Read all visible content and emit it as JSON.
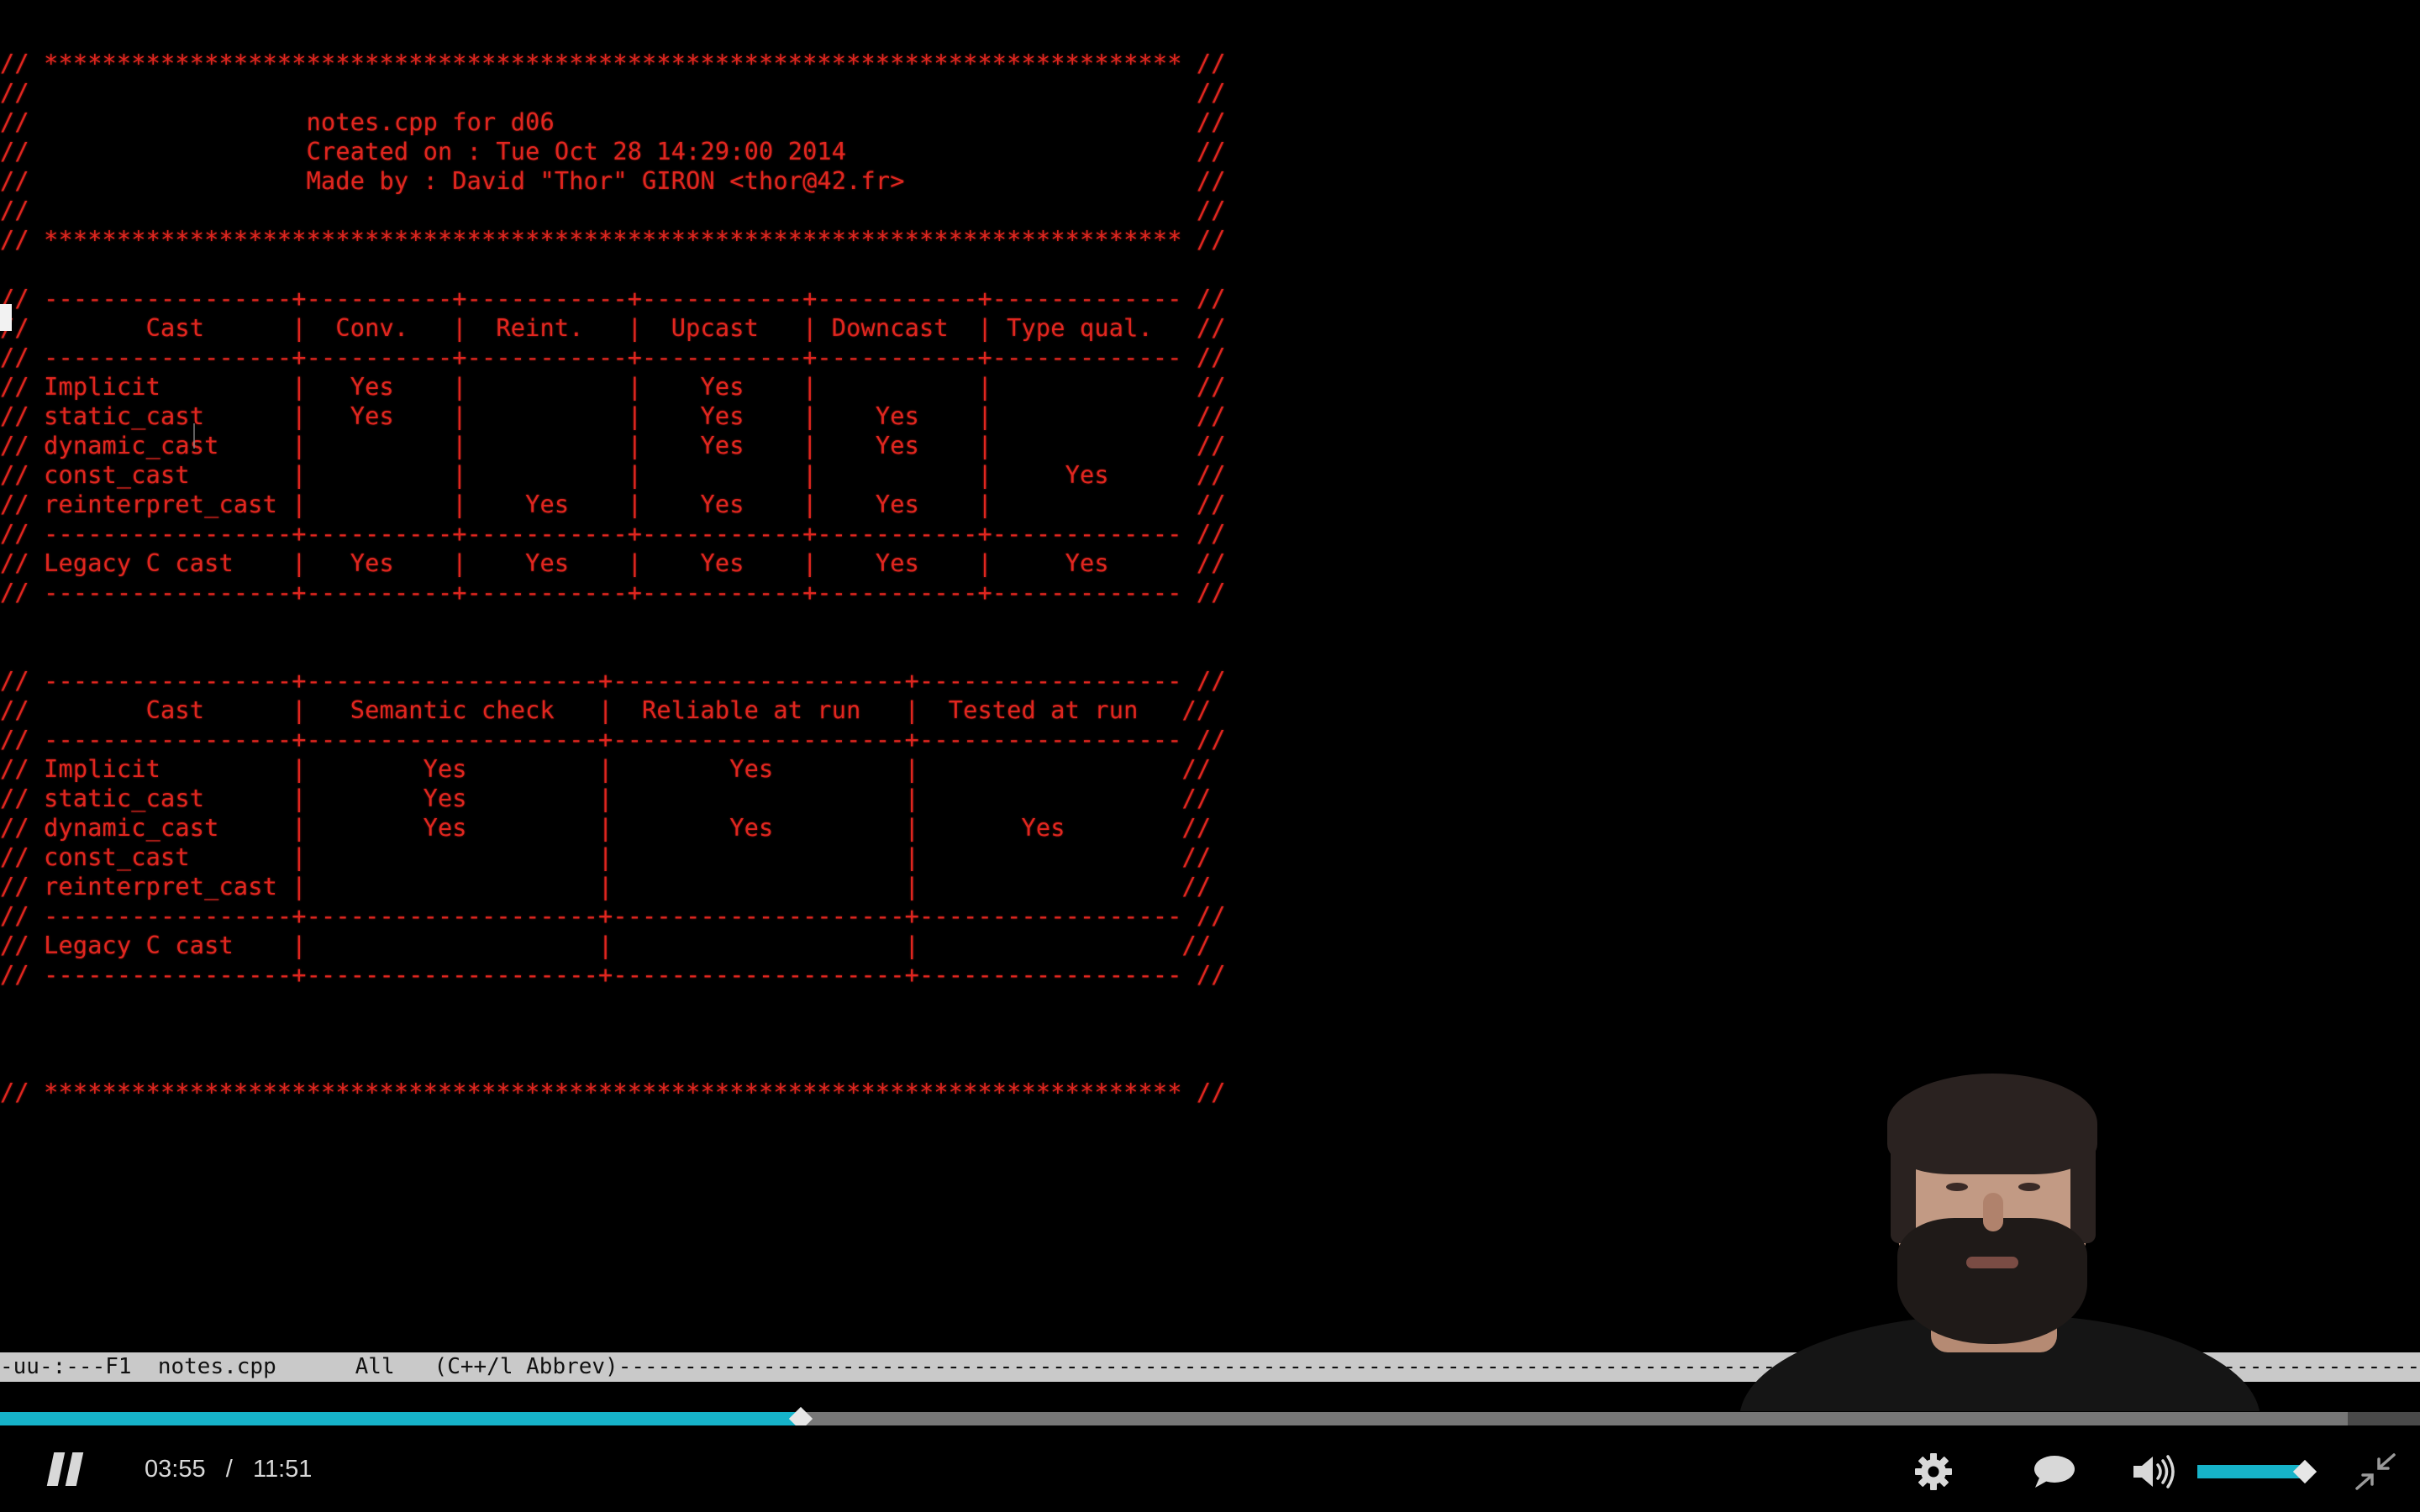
{
  "editor": {
    "lines": [
      {
        "row": 1,
        "text": "// ****************************************************************************** //"
      },
      {
        "row": 2,
        "text": "//                                                                                //"
      },
      {
        "row": 3,
        "text": "//                   notes.cpp for d06                                            //"
      },
      {
        "row": 4,
        "text": "//                   Created on : Tue Oct 28 14:29:00 2014                        //"
      },
      {
        "row": 5,
        "text": "//                   Made by : David \"Thor\" GIRON <thor@42.fr>                    //"
      },
      {
        "row": 6,
        "text": "//                                                                                //"
      },
      {
        "row": 7,
        "text": "// ****************************************************************************** //"
      },
      {
        "row": 9,
        "text": "// -----------------+----------+-----------+-----------+-----------+------------- //"
      },
      {
        "row": 10,
        "text": "//        Cast      |  Conv.   |  Reint.   |  Upcast   | Downcast  | Type qual.   //"
      },
      {
        "row": 11,
        "text": "// -----------------+----------+-----------+-----------+-----------+------------- //"
      },
      {
        "row": 12,
        "text": "// Implicit         |   Yes    |           |    Yes    |           |              //"
      },
      {
        "row": 13,
        "text": "// static_cast      |   Yes    |           |    Yes    |    Yes    |              //"
      },
      {
        "row": 14,
        "text": "// dynamic_cast     |          |           |    Yes    |    Yes    |              //"
      },
      {
        "row": 15,
        "text": "// const_cast       |          |           |           |           |     Yes      //"
      },
      {
        "row": 16,
        "text": "// reinterpret_cast |          |    Yes    |    Yes    |    Yes    |              //"
      },
      {
        "row": 17,
        "text": "// -----------------+----------+-----------+-----------+-----------+------------- //"
      },
      {
        "row": 18,
        "text": "// Legacy C cast    |   Yes    |    Yes    |    Yes    |    Yes    |     Yes      //"
      },
      {
        "row": 19,
        "text": "// -----------------+----------+-----------+-----------+-----------+------------- //"
      },
      {
        "row": 22,
        "text": "// -----------------+--------------------+--------------------+------------------ //"
      },
      {
        "row": 23,
        "text": "//        Cast      |   Semantic check   |  Reliable at run   |  Tested at run   //"
      },
      {
        "row": 24,
        "text": "// -----------------+--------------------+--------------------+------------------ //"
      },
      {
        "row": 25,
        "text": "// Implicit         |        Yes         |        Yes         |                  //"
      },
      {
        "row": 26,
        "text": "// static_cast      |        Yes         |                    |                  //"
      },
      {
        "row": 27,
        "text": "// dynamic_cast     |        Yes         |        Yes         |       Yes        //"
      },
      {
        "row": 28,
        "text": "// const_cast       |                    |                    |                  //"
      },
      {
        "row": 29,
        "text": "// reinterpret_cast |                    |                    |                  //"
      },
      {
        "row": 30,
        "text": "// -----------------+--------------------+--------------------+------------------ //"
      },
      {
        "row": 31,
        "text": "// Legacy C cast    |                    |                    |                  //"
      },
      {
        "row": 32,
        "text": "// -----------------+--------------------+--------------------+------------------ //"
      },
      {
        "row": 36,
        "text": "// ****************************************************************************** //"
      }
    ],
    "modeline": "-uu-:---F1  notes.cpp      All   (C++/l Abbrev)-----------------------------------------------------------------------------------------------------------------------------------------------------------------------------------------------------------------"
  },
  "player": {
    "progress_fraction": 0.331,
    "buffered_fraction": 0.97,
    "current_time": "03:55",
    "time_separator": "/",
    "duration": "11:51",
    "volume_fraction": 0.9,
    "icons": {
      "play_pause": "pause-icon",
      "settings": "gear-icon",
      "captions": "speech-bubble-icon",
      "volume": "speaker-icon",
      "fullscreen": "exit-fullscreen-icon"
    },
    "accent_color": "#16b3c9"
  },
  "colors": {
    "terminal_text": "#e0261f",
    "terminal_bg": "#000000",
    "modeline_bg": "#c9c9c9"
  }
}
